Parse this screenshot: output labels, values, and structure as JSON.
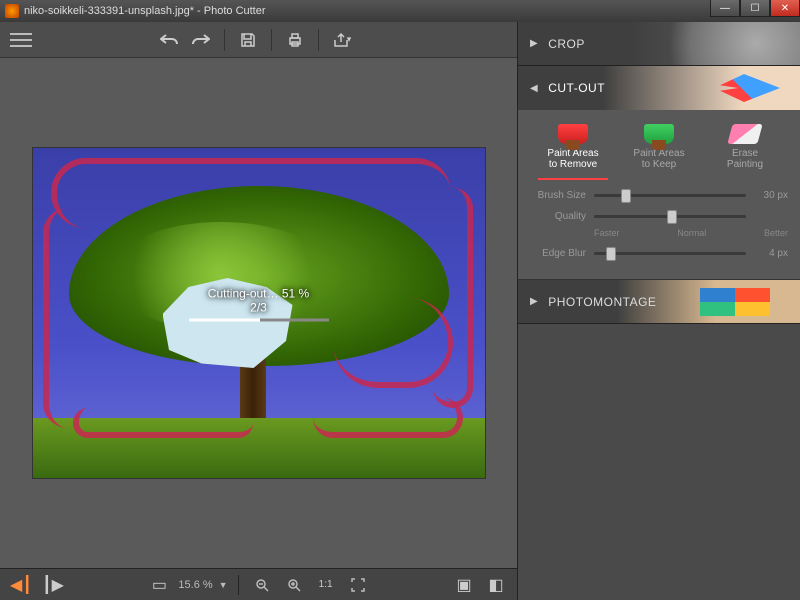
{
  "window": {
    "title": "niko-soikkeli-333391-unsplash.jpg* - Photo Cutter"
  },
  "toolbar": {
    "undo": "↶",
    "redo": "↷",
    "save": "💾",
    "print": "🖨",
    "share": "↗"
  },
  "progress": {
    "label": "Cutting-out… 51 %",
    "step": "2/3",
    "percent": 51
  },
  "statusbar": {
    "zoom": "15.6 %"
  },
  "panels": {
    "crop": "CROP",
    "cutout": "CUT-OUT",
    "photomontage": "PHOTOMONTAGE"
  },
  "cutout": {
    "tools": {
      "remove_l1": "Paint Areas",
      "remove_l2": "to Remove",
      "keep_l1": "Paint Areas",
      "keep_l2": "to Keep",
      "erase_l1": "Erase",
      "erase_l2": "Painting"
    },
    "brush_size": {
      "label": "Brush Size",
      "value": "30 px",
      "pos": 18
    },
    "quality": {
      "label": "Quality",
      "faster": "Faster",
      "normal": "Normal",
      "better": "Better",
      "pos": 48
    },
    "edge_blur": {
      "label": "Edge Blur",
      "value": "4 px",
      "pos": 8
    }
  }
}
